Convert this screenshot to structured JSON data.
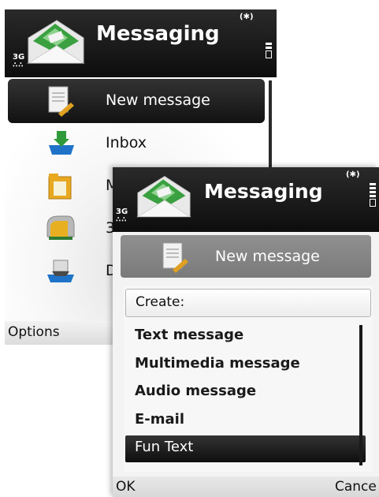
{
  "back_screen": {
    "title": "Messaging",
    "network": "3G",
    "bluetooth": "(✱)",
    "items": [
      {
        "label": "New message",
        "icon": "new-message-icon",
        "selected": true
      },
      {
        "label": "Inbox",
        "icon": "inbox-icon"
      },
      {
        "label": "M",
        "icon": "folder-icon"
      },
      {
        "label": "3",
        "icon": "mailbox-icon"
      },
      {
        "label": "D",
        "icon": "drafts-icon"
      }
    ],
    "left_softkey": "Options"
  },
  "front_screen": {
    "title": "Messaging",
    "network": "3G",
    "bluetooth": "(✱)",
    "new_message_label": "New message",
    "menu": {
      "heading": "Create:",
      "options": [
        "Text message",
        "Multimedia message",
        "Audio message",
        "E-mail",
        "Fun Text"
      ],
      "selected": "Fun Text"
    },
    "left_softkey": "OK",
    "right_softkey": "Cance"
  },
  "colors": {
    "titlebar": "#111111",
    "selection": "#1a1a1a",
    "envelope_green": "#3aa040"
  }
}
